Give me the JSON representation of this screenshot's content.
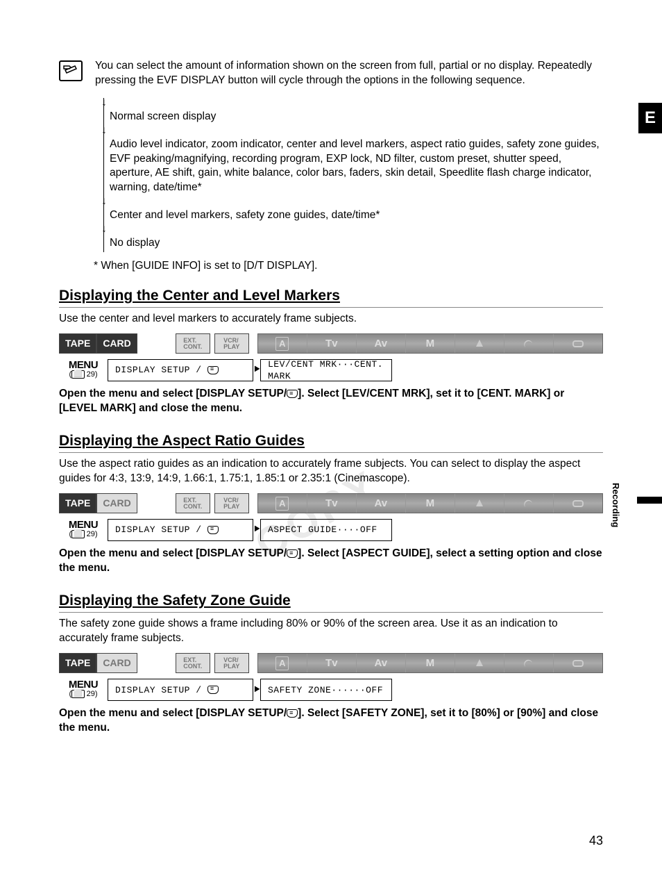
{
  "sideTab": "E",
  "sideLabel": "Recording",
  "intro": "You can select the amount of information shown on the screen from full, partial or no display. Repeatedly pressing the EVF DISPLAY button will cycle through the options in the following sequence.",
  "flow1": "Normal screen display",
  "flow2": "Audio level indicator, zoom indicator, center and level markers, aspect ratio guides, safety zone guides, EVF peaking/magnifying, recording program, EXP lock, ND filter, custom preset, shutter speed, aperture, AE shift, gain, white balance, color bars, faders, skin detail, Speedlite flash charge indicator, warning, date/time*",
  "flow3": "Center and level markers, safety zone guides, date/time*",
  "flow4": "No display",
  "footnote": "* When [GUIDE INFO] is set to [D/T DISPLAY].",
  "section1": {
    "heading": "Displaying the Center and Level Markers",
    "desc": "Use the center and level markers to accurately frame subjects.",
    "menuWord": "MENU",
    "menuRef": "29",
    "menuPath1": "DISPLAY SETUP /",
    "menuPath2": "LEV/CENT MRK···CENT. MARK",
    "instructionA": "Open the menu and select [DISPLAY SETUP/",
    "instructionB": "]. Select [LEV/CENT MRK], set it to [CENT. MARK] or [LEVEL MARK] and close the menu."
  },
  "section2": {
    "heading": "Displaying the Aspect Ratio Guides",
    "desc": "Use the aspect ratio guides as an indication to accurately frame subjects. You can select to display the aspect guides for 4:3, 13:9, 14:9, 1.66:1, 1.75:1, 1.85:1 or 2.35:1 (Cinemascope).",
    "menuWord": "MENU",
    "menuRef": "29",
    "menuPath1": "DISPLAY SETUP /",
    "menuPath2": "ASPECT GUIDE····OFF",
    "instructionA": "Open the menu and select [DISPLAY SETUP/",
    "instructionB": "]. Select [ASPECT GUIDE], select a setting option and close the menu."
  },
  "section3": {
    "heading": "Displaying the Safety Zone Guide",
    "desc": "The safety zone guide shows a frame including 80% or 90% of the screen area. Use it as an indication to accurately frame subjects.",
    "menuWord": "MENU",
    "menuRef": "29",
    "menuPath1": "DISPLAY SETUP /",
    "menuPath2": "SAFETY ZONE······OFF",
    "instructionA": "Open the menu and select [DISPLAY SETUP/",
    "instructionB": "]. Select [SAFETY ZONE], set it to [80%] or [90%] and close the menu."
  },
  "modeBar": {
    "tape": "TAPE",
    "card": "CARD",
    "ext": "EXT.\nCONT.",
    "vcr": "VCR/\nPLAY",
    "strip": {
      "a": "A",
      "tv": "Tv",
      "av": "Av",
      "m": "M"
    }
  },
  "pageNum": "43"
}
